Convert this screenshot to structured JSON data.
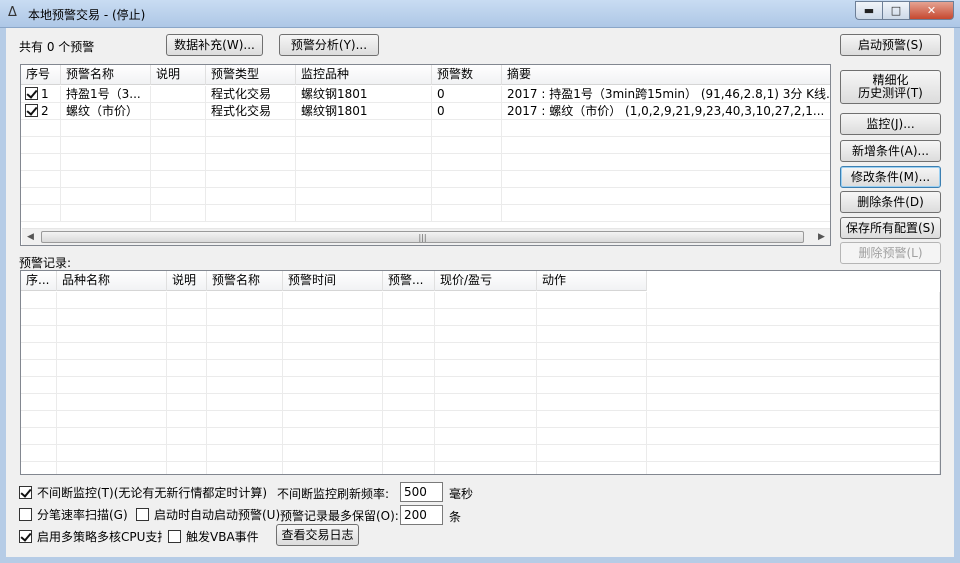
{
  "window": {
    "title": "本地预警交易 - (停止)",
    "min_icon": "minimize-icon",
    "max_icon": "maximize-icon",
    "close_icon": "close-icon"
  },
  "top": {
    "count_label": "共有 0 个预警",
    "data_supplement_btn": "数据补充(W)...",
    "alert_analysis_btn": "预警分析(Y)..."
  },
  "alerts_table": {
    "columns": [
      "序号",
      "预警名称",
      "说明",
      "预警类型",
      "监控品种",
      "预警数",
      "摘要"
    ],
    "rows": [
      {
        "checked": true,
        "no": "1",
        "name": "持盈1号（3...",
        "desc": "",
        "type": "程式化交易",
        "symbol": "螺纹钢1801",
        "count": "0",
        "summary": "2017 : 持盈1号（3min跨15min） (91,46,2.8,1) 3分 K线..."
      },
      {
        "checked": true,
        "no": "2",
        "name": "螺纹（市价）",
        "desc": "",
        "type": "程式化交易",
        "symbol": "螺纹钢1801",
        "count": "0",
        "summary": "2017 : 螺纹（市价） (1,0,2,9,21,9,23,40,3,10,27,2,1..."
      }
    ]
  },
  "records_label": "预警记录:",
  "records_table": {
    "columns": [
      "序...",
      "品种名称",
      "说明",
      "预警名称",
      "预警时间",
      "预警...",
      "现价/盈亏",
      "动作"
    ]
  },
  "side_buttons": {
    "start_alert": "启动预警(S)",
    "refined_backtest_line1": "精细化",
    "refined_backtest_line2": "历史测评(T)",
    "monitor": "监控(J)...",
    "add_condition": "新增条件(A)...",
    "modify_condition": "修改条件(M)...",
    "delete_condition": "删除条件(D)",
    "save_all_config": "保存所有配置(S)",
    "delete_alert": "删除预警(L)"
  },
  "options": {
    "continuous_monitor": {
      "checked": true,
      "label": "不间断监控(T)(无论有无新行情都定时计算)"
    },
    "refresh_rate_label": "不间断监控刷新频率:",
    "refresh_rate_value": "500",
    "refresh_rate_unit": "毫秒",
    "tick_scan": {
      "checked": false,
      "label": "分笔速率扫描(G)"
    },
    "auto_start": {
      "checked": false,
      "label": "启动时自动启动预警(U)"
    },
    "max_records_label": "预警记录最多保留(O):",
    "max_records_value": "200",
    "max_records_unit": "条",
    "multicore": {
      "checked": true,
      "label": "启用多策略多核CPU支持"
    },
    "vba_event": {
      "checked": false,
      "label": "触发VBA事件"
    },
    "view_log_btn": "查看交易日志"
  }
}
